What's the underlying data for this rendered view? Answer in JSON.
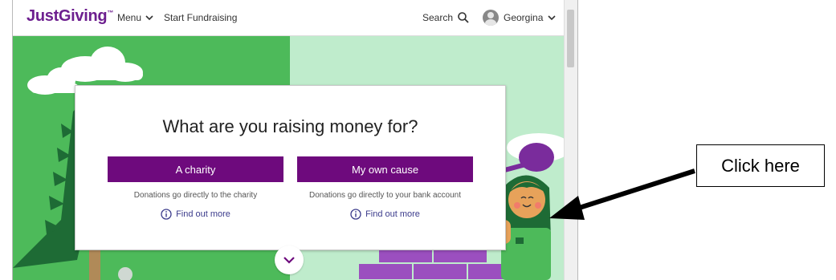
{
  "header": {
    "logo": "JustGiving",
    "logo_mark": "™",
    "menu_label": "Menu",
    "start_label": "Start Fundraising",
    "search_label": "Search",
    "user_name": "Georgina"
  },
  "card": {
    "heading": "What are you raising money for?",
    "options": [
      {
        "button": "A charity",
        "desc": "Donations go directly to the charity",
        "link": "Find out more"
      },
      {
        "button": "My own cause",
        "desc": "Donations go directly to your bank account",
        "link": "Find out more"
      }
    ]
  },
  "annotation": {
    "callout": "Click here"
  },
  "colors": {
    "brand": "#6d1f8f",
    "button": "#6e0a7d",
    "hero_green": "#4dba5a",
    "hero_light": "#bfeccc"
  },
  "icons": [
    "chevron-down-icon",
    "search-icon",
    "user-avatar-icon",
    "info-icon",
    "scroll-down-icon"
  ]
}
